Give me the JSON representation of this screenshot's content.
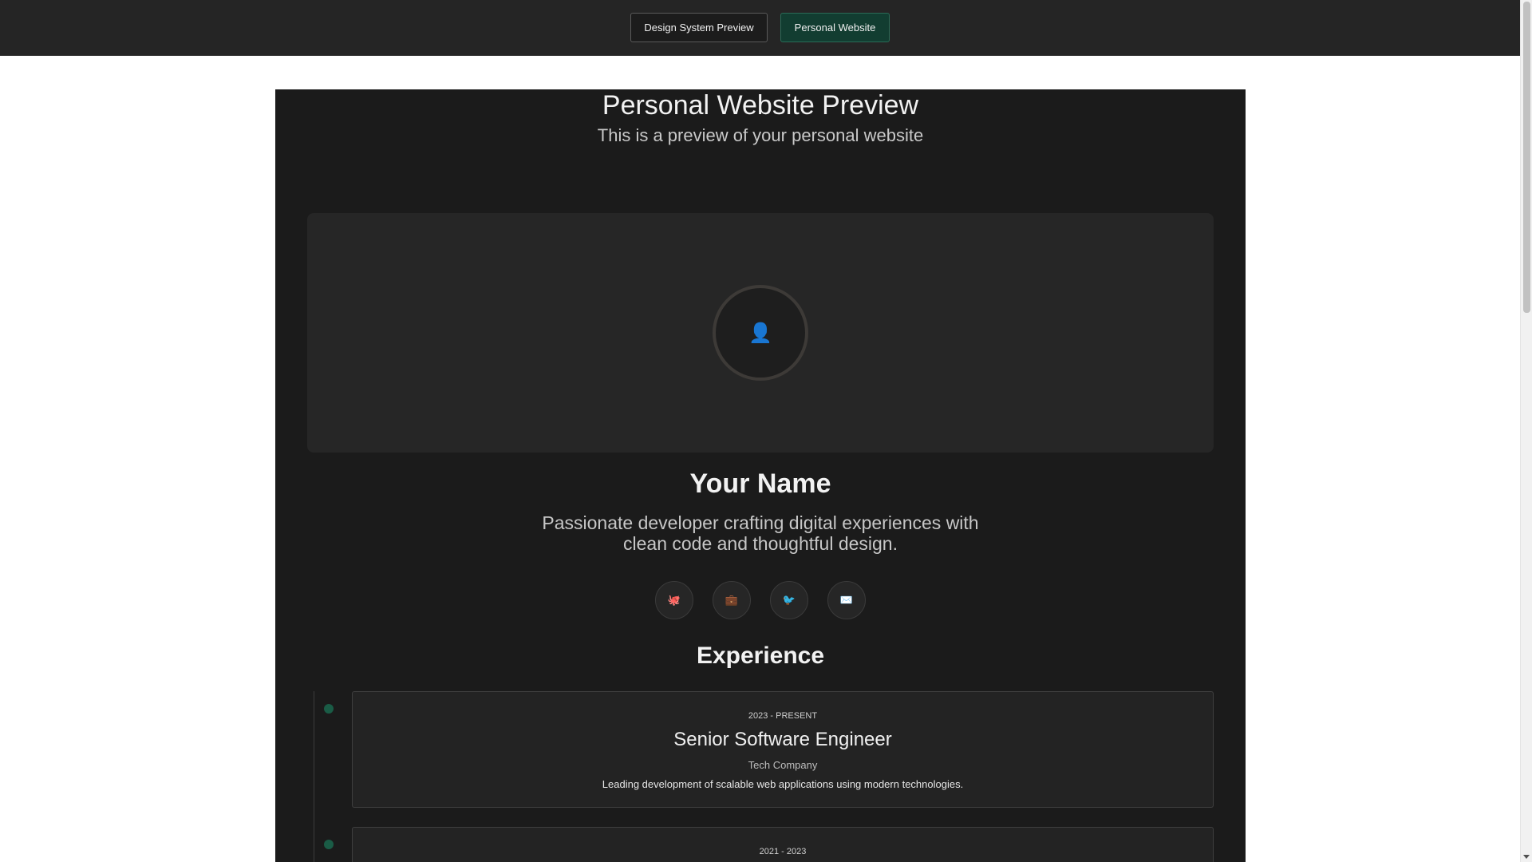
{
  "nav": {
    "design_system_label": "Design System Preview",
    "personal_website_label": "Personal Website"
  },
  "page": {
    "title": "Personal Website Preview",
    "subtitle": "This is a preview of your personal website"
  },
  "profile": {
    "avatar_icon": "👤",
    "name": "Your Name",
    "tagline": "Passionate developer crafting digital experiences with clean code and thoughtful design."
  },
  "socials": [
    {
      "icon": "🐙",
      "name": "github-icon"
    },
    {
      "icon": "💼",
      "name": "linkedin-icon"
    },
    {
      "icon": "🐦",
      "name": "twitter-icon"
    },
    {
      "icon": "✉️",
      "name": "email-icon"
    }
  ],
  "experience": {
    "heading": "Experience",
    "items": [
      {
        "date": "2023 - PRESENT",
        "role": "Senior Software Engineer",
        "company": "Tech Company",
        "description": "Leading development of scalable web applications using modern technologies."
      },
      {
        "date": "2021 - 2023"
      }
    ]
  },
  "colors": {
    "accent": "#123d31",
    "timeline_dot": "#1a5c46",
    "panel_bg": "#1b1b1b",
    "card_bg": "#262626"
  }
}
